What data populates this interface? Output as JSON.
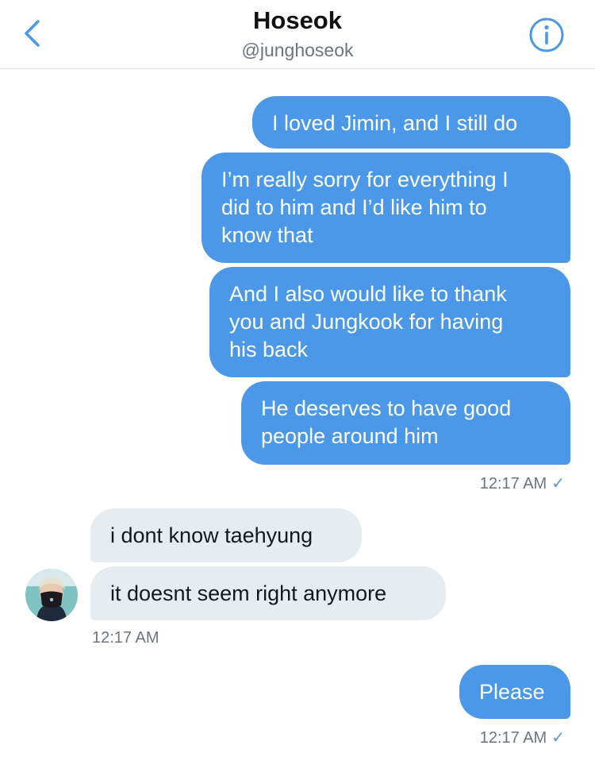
{
  "header": {
    "name": "Hoseok",
    "handle": "@junghoseok",
    "back_icon": "chevron-left-icon",
    "info_icon": "info-icon",
    "accent_color": "#4a98e7"
  },
  "messages": {
    "m1": "I loved Jimin, and I still do",
    "m2_l1": "I’m really sorry for everything I",
    "m2_l2": "did to him and I’d like him to",
    "m2_l3": "know that",
    "m3_l1": "And I also would like to thank",
    "m3_l2": "you and Jungkook for having",
    "m3_l3": "his back",
    "m4_l1": "He deserves to have good",
    "m4_l2": "people around him",
    "ts1": "12:17 AM",
    "r1": "i dont know taehyung",
    "r2": "it doesnt seem right anymore",
    "ts2": "12:17 AM",
    "m5": "Please",
    "ts3": "12:17 AM",
    "read_icon": "checkmark-icon",
    "read_mark": "✓"
  }
}
